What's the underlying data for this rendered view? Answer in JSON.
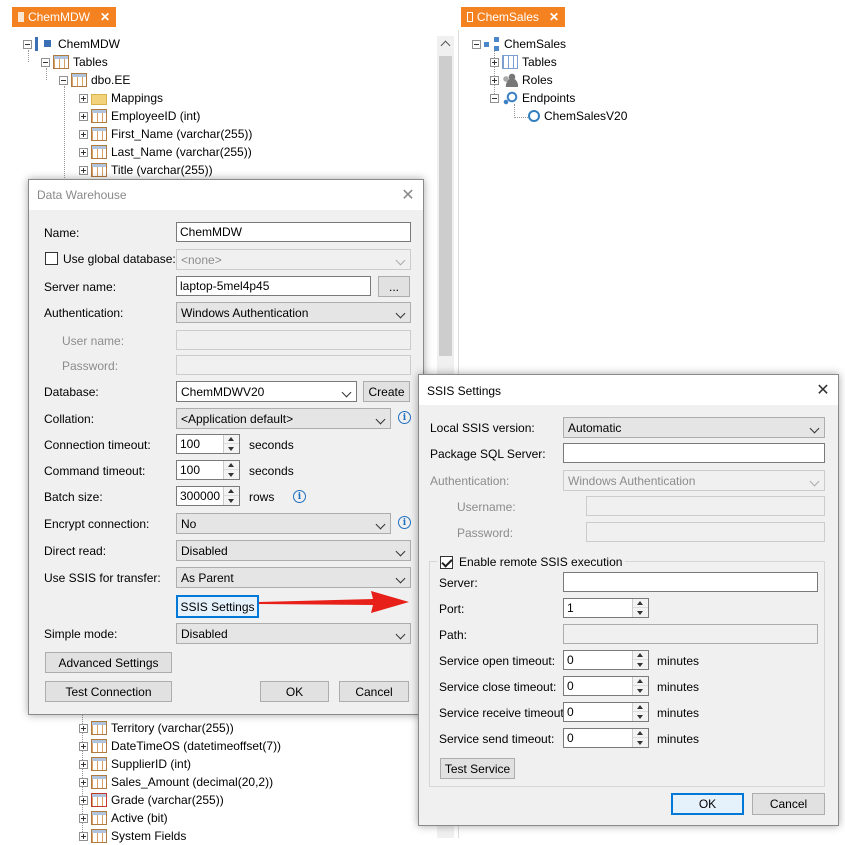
{
  "left_tab": {
    "label": "ChemMDW",
    "close": "✕"
  },
  "right_tab": {
    "label": "ChemSales",
    "close": "✕"
  },
  "left_tree": {
    "root": "ChemMDW",
    "tables": "Tables",
    "table": "dbo.EE",
    "columns_top": [
      "Mappings",
      "EmployeeID (int)",
      "First_Name (varchar(255))",
      "Last_Name (varchar(255))",
      "Title (varchar(255))"
    ],
    "columns_bottom": [
      "Territory (varchar(255))",
      "DateTimeOS (datetimeoffset(7))",
      "SupplierID (int)",
      "Sales_Amount (decimal(20,2))",
      "Grade (varchar(255))",
      "Active (bit)",
      "System Fields"
    ]
  },
  "right_tree": {
    "root": "ChemSales",
    "items": [
      "Tables",
      "Roles",
      "Endpoints"
    ],
    "endpoint": "ChemSalesV20"
  },
  "dw_dialog": {
    "title": "Data Warehouse",
    "close": "✕",
    "name_label": "Name:",
    "name_value": "ChemMDW",
    "use_global_label": "Use global database:",
    "global_db_value": "<none>",
    "server_label": "Server name:",
    "server_value": "laptop-5mel4p45",
    "browse_label": "...",
    "auth_label": "Authentication:",
    "auth_value": "Windows Authentication",
    "user_label": "User name:",
    "password_label": "Password:",
    "database_label": "Database:",
    "database_value": "ChemMDWV20",
    "create_label": "Create",
    "collation_label": "Collation:",
    "collation_value": "<Application default>",
    "conn_timeout_label": "Connection timeout:",
    "conn_timeout_value": "100",
    "conn_timeout_unit": "seconds",
    "cmd_timeout_label": "Command timeout:",
    "cmd_timeout_value": "100",
    "cmd_timeout_unit": "seconds",
    "batch_label": "Batch size:",
    "batch_value": "300000",
    "batch_unit": "rows",
    "encrypt_label": "Encrypt connection:",
    "encrypt_value": "No",
    "direct_read_label": "Direct read:",
    "direct_read_value": "Disabled",
    "ssis_label": "Use SSIS for transfer:",
    "ssis_value": "As Parent",
    "ssis_settings_btn": "SSIS Settings",
    "simple_mode_label": "Simple mode:",
    "simple_mode_value": "Disabled",
    "advanced_btn": "Advanced Settings",
    "test_btn": "Test Connection",
    "ok_btn": "OK",
    "cancel_btn": "Cancel",
    "info_glyph": "i"
  },
  "ssis_dialog": {
    "title": "SSIS Settings",
    "close": "✕",
    "local_version_label": "Local SSIS version:",
    "local_version_value": "Automatic",
    "package_sql_label": "Package SQL Server:",
    "package_sql_value": "",
    "auth_label": "Authentication:",
    "auth_value": "Windows Authentication",
    "username_label": "Username:",
    "password_label": "Password:",
    "enable_remote_label": "Enable remote SSIS execution",
    "server_label": "Server:",
    "server_value": "",
    "port_label": "Port:",
    "port_value": "1",
    "path_label": "Path:",
    "open_timeout_label": "Service open timeout:",
    "open_timeout_value": "0",
    "close_timeout_label": "Service close timeout:",
    "close_timeout_value": "0",
    "receive_timeout_label": "Service receive timeout:",
    "receive_timeout_value": "0",
    "send_timeout_label": "Service send timeout:",
    "send_timeout_value": "0",
    "minutes_unit": "minutes",
    "test_service_btn": "Test Service",
    "ok_btn": "OK",
    "cancel_btn": "Cancel"
  },
  "colors": {
    "tab_orange": "#f58220",
    "arrow_red": "#e8201a",
    "focus_blue": "#0078d7"
  }
}
